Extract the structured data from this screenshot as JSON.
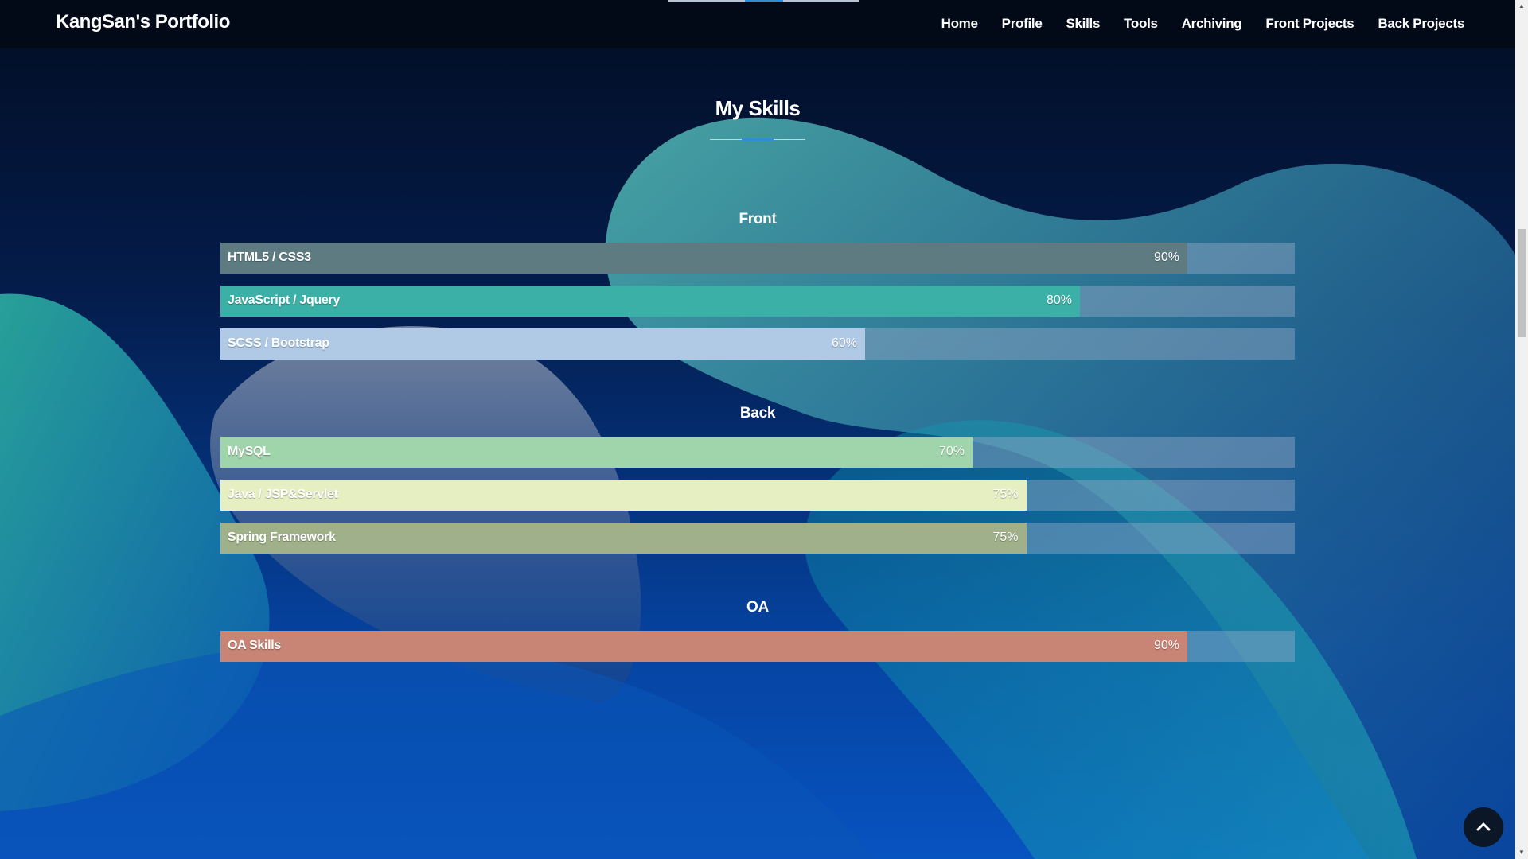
{
  "brand": "KangSan's Portfolio",
  "nav": [
    "Home",
    "Profile",
    "Skills",
    "Tools",
    "Archiving",
    "Front Projects",
    "Back Projects"
  ],
  "section_title": "My Skills",
  "groups": [
    {
      "title": "Front",
      "skills": [
        {
          "name": "HTML5 / CSS3",
          "percent_text": "90%",
          "value": 90,
          "color": "#5e7b82"
        },
        {
          "name": "JavaScript / Jquery",
          "percent_text": "80%",
          "value": 80,
          "color": "#3bb0a6"
        },
        {
          "name": "SCSS / Bootstrap",
          "percent_text": "60%",
          "value": 60,
          "color": "#b0cae6"
        }
      ]
    },
    {
      "title": "Back",
      "skills": [
        {
          "name": "MySQL",
          "percent_text": "70%",
          "value": 70,
          "color": "#a0d4aa"
        },
        {
          "name": "Java / JSP&Servlet",
          "percent_text": "75%",
          "value": 75,
          "color": "#e6efc1"
        },
        {
          "name": "Spring Framework",
          "percent_text": "75%",
          "value": 75,
          "color": "#a0b08a"
        }
      ]
    },
    {
      "title": "OA",
      "skills": [
        {
          "name": "OA Skills",
          "percent_text": "90%",
          "value": 90,
          "color": "#c88474"
        }
      ]
    }
  ],
  "icons": {
    "scroll_top": "chevron-up-icon"
  }
}
